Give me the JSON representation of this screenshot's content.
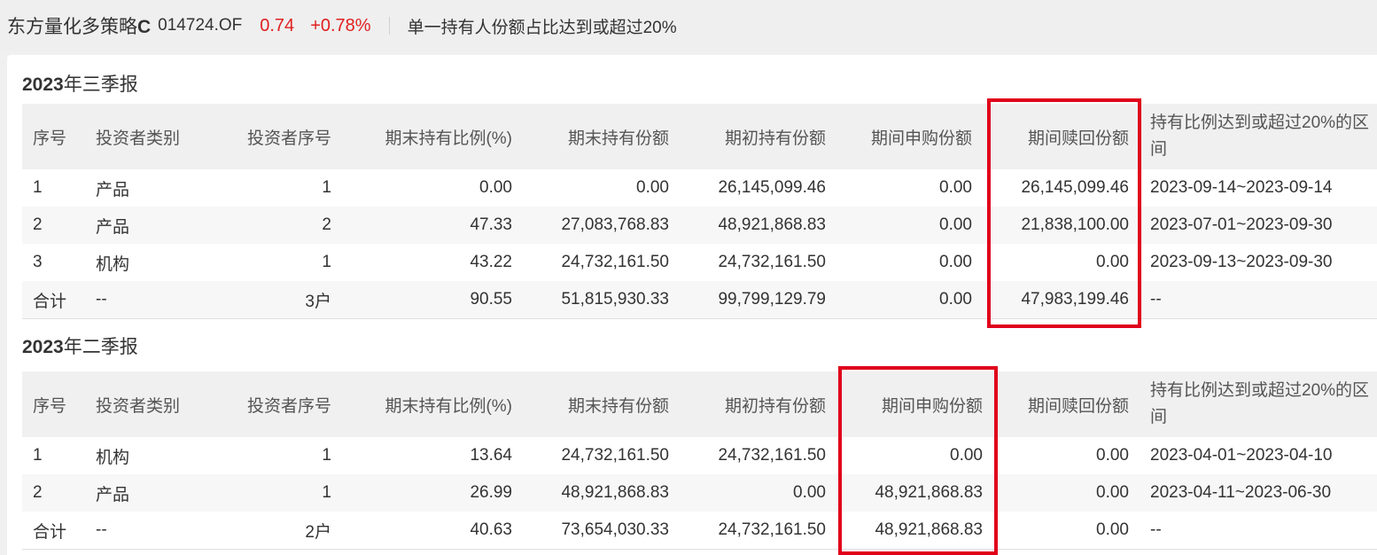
{
  "header": {
    "fund_name_prefix": "东方量化多策略",
    "fund_name_suffix": "C",
    "fund_code": "014724.OF",
    "price": "0.74",
    "change": "+0.78%",
    "subtitle": "单一持有人份额占比达到或超过20%"
  },
  "columns": [
    "序号",
    "投资者类别",
    "投资者序号",
    "期末持有比例(%)",
    "期末持有份额",
    "期初持有份额",
    "期间申购份额",
    "期间赎回份额",
    "持有比例达到或超过20%的区间"
  ],
  "reports": [
    {
      "year": "2023",
      "period": "年三季报",
      "rows": [
        [
          "1",
          "产品",
          "1",
          "0.00",
          "0.00",
          "26,145,099.46",
          "0.00",
          "26,145,099.46",
          "2023-09-14~2023-09-14"
        ],
        [
          "2",
          "产品",
          "2",
          "47.33",
          "27,083,768.83",
          "48,921,868.83",
          "0.00",
          "21,838,100.00",
          "2023-07-01~2023-09-30"
        ],
        [
          "3",
          "机构",
          "1",
          "43.22",
          "24,732,161.50",
          "24,732,161.50",
          "0.00",
          "0.00",
          "2023-09-13~2023-09-30"
        ],
        [
          "合计",
          "--",
          "3户",
          "90.55",
          "51,815,930.33",
          "99,799,129.79",
          "0.00",
          "47,983,199.46",
          "--"
        ]
      ]
    },
    {
      "year": "2023",
      "period": "年二季报",
      "rows": [
        [
          "1",
          "机构",
          "1",
          "13.64",
          "24,732,161.50",
          "24,732,161.50",
          "0.00",
          "0.00",
          "2023-04-01~2023-04-10"
        ],
        [
          "2",
          "产品",
          "1",
          "26.99",
          "48,921,868.83",
          "0.00",
          "48,921,868.83",
          "0.00",
          "2023-04-11~2023-06-30"
        ],
        [
          "合计",
          "--",
          "2户",
          "40.63",
          "73,654,030.33",
          "24,732,161.50",
          "48,921,868.83",
          "0.00",
          "--"
        ]
      ]
    }
  ],
  "colors": {
    "accent_red": "#e0001b",
    "price_red": "#e02020"
  }
}
